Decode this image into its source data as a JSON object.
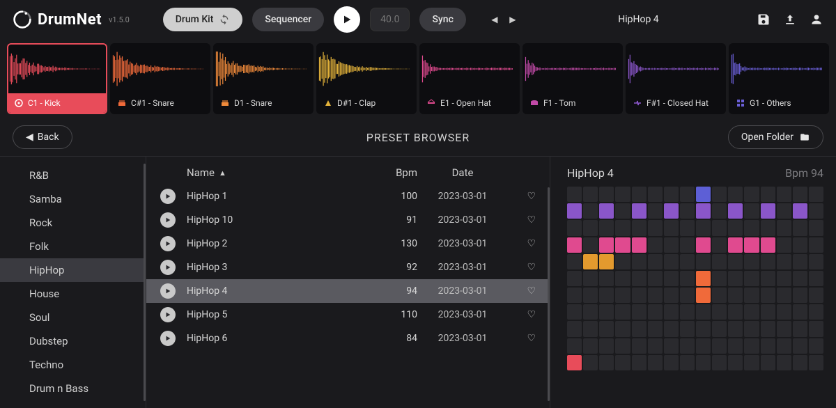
{
  "app": {
    "name": "DrumNet",
    "version": "v1.5.0"
  },
  "topbar": {
    "drumkit_label": "Drum Kit",
    "sequencer_label": "Sequencer",
    "bpm_value": "40.0",
    "sync_label": "Sync",
    "preset_name": "HipHop 4"
  },
  "pads": [
    {
      "label": "C1 - Kick",
      "color": "#e84c5a",
      "selected": true
    },
    {
      "label": "C#1 - Snare",
      "color": "#f06a3a",
      "selected": false
    },
    {
      "label": "D1 - Snare",
      "color": "#f08a3a",
      "selected": false
    },
    {
      "label": "D#1 - Clap",
      "color": "#e3b23a",
      "selected": false
    },
    {
      "label": "E1 - Open Hat",
      "color": "#e04a8f",
      "selected": false
    },
    {
      "label": "F1 - Tom",
      "color": "#c24aa8",
      "selected": false
    },
    {
      "label": "F#1 - Closed Hat",
      "color": "#8a56c9",
      "selected": false
    },
    {
      "label": "G1 - Others",
      "color": "#6a5fd6",
      "selected": false
    }
  ],
  "browser": {
    "back_label": "Back",
    "title": "PRESET BROWSER",
    "open_folder_label": "Open Folder"
  },
  "genres": [
    "R&B",
    "Samba",
    "Rock",
    "Folk",
    "HipHop",
    "House",
    "Soul",
    "Dubstep",
    "Techno",
    "Drum n Bass"
  ],
  "genre_selected": "HipHop",
  "columns": {
    "name": "Name",
    "bpm": "Bpm",
    "date": "Date"
  },
  "presets": [
    {
      "name": "HipHop 1",
      "bpm": 100,
      "date": "2023-03-01",
      "fav": false
    },
    {
      "name": "HipHop 10",
      "bpm": 91,
      "date": "2023-03-01",
      "fav": false
    },
    {
      "name": "HipHop 2",
      "bpm": 130,
      "date": "2023-03-01",
      "fav": false
    },
    {
      "name": "HipHop 3",
      "bpm": 92,
      "date": "2023-03-01",
      "fav": false
    },
    {
      "name": "HipHop 4",
      "bpm": 94,
      "date": "2023-03-01",
      "fav": false
    },
    {
      "name": "HipHop 5",
      "bpm": 110,
      "date": "2023-03-01",
      "fav": false
    },
    {
      "name": "HipHop 6",
      "bpm": 84,
      "date": "2023-03-01",
      "fav": false
    }
  ],
  "preset_selected": "HipHop 4",
  "preview": {
    "name": "HipHop 4",
    "bpm_label": "Bpm 94"
  },
  "grid": {
    "cols": 16,
    "rows": 11,
    "cells": [
      {
        "r": 0,
        "c": 8,
        "cls": "on1"
      },
      {
        "r": 1,
        "c": 0,
        "cls": "on2"
      },
      {
        "r": 1,
        "c": 2,
        "cls": "on2"
      },
      {
        "r": 1,
        "c": 4,
        "cls": "on2"
      },
      {
        "r": 1,
        "c": 6,
        "cls": "on2"
      },
      {
        "r": 1,
        "c": 8,
        "cls": "on2"
      },
      {
        "r": 1,
        "c": 10,
        "cls": "on2"
      },
      {
        "r": 1,
        "c": 12,
        "cls": "on2"
      },
      {
        "r": 1,
        "c": 14,
        "cls": "on2"
      },
      {
        "r": 3,
        "c": 0,
        "cls": "on3"
      },
      {
        "r": 3,
        "c": 2,
        "cls": "on3"
      },
      {
        "r": 3,
        "c": 3,
        "cls": "on3"
      },
      {
        "r": 3,
        "c": 4,
        "cls": "on3"
      },
      {
        "r": 3,
        "c": 8,
        "cls": "on3"
      },
      {
        "r": 3,
        "c": 10,
        "cls": "on3"
      },
      {
        "r": 3,
        "c": 11,
        "cls": "on3"
      },
      {
        "r": 3,
        "c": 12,
        "cls": "on3"
      },
      {
        "r": 4,
        "c": 1,
        "cls": "on4"
      },
      {
        "r": 4,
        "c": 2,
        "cls": "on4"
      },
      {
        "r": 5,
        "c": 8,
        "cls": "on5"
      },
      {
        "r": 6,
        "c": 8,
        "cls": "on5"
      },
      {
        "r": 10,
        "c": 0,
        "cls": "on6"
      }
    ]
  }
}
